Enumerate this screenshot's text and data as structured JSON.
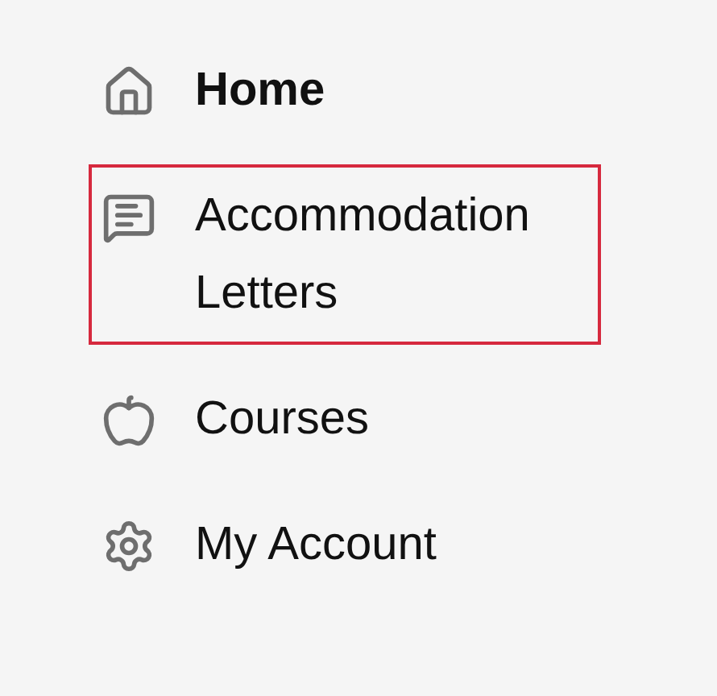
{
  "nav": {
    "items": [
      {
        "kind": "home",
        "label": "Home",
        "selected": true,
        "focused": false
      },
      {
        "kind": "letters",
        "label": "Accommodation Letters",
        "selected": false,
        "focused": true
      },
      {
        "kind": "courses",
        "label": "Courses",
        "selected": false,
        "focused": false
      },
      {
        "kind": "account",
        "label": "My Account",
        "selected": false,
        "focused": false
      }
    ]
  }
}
